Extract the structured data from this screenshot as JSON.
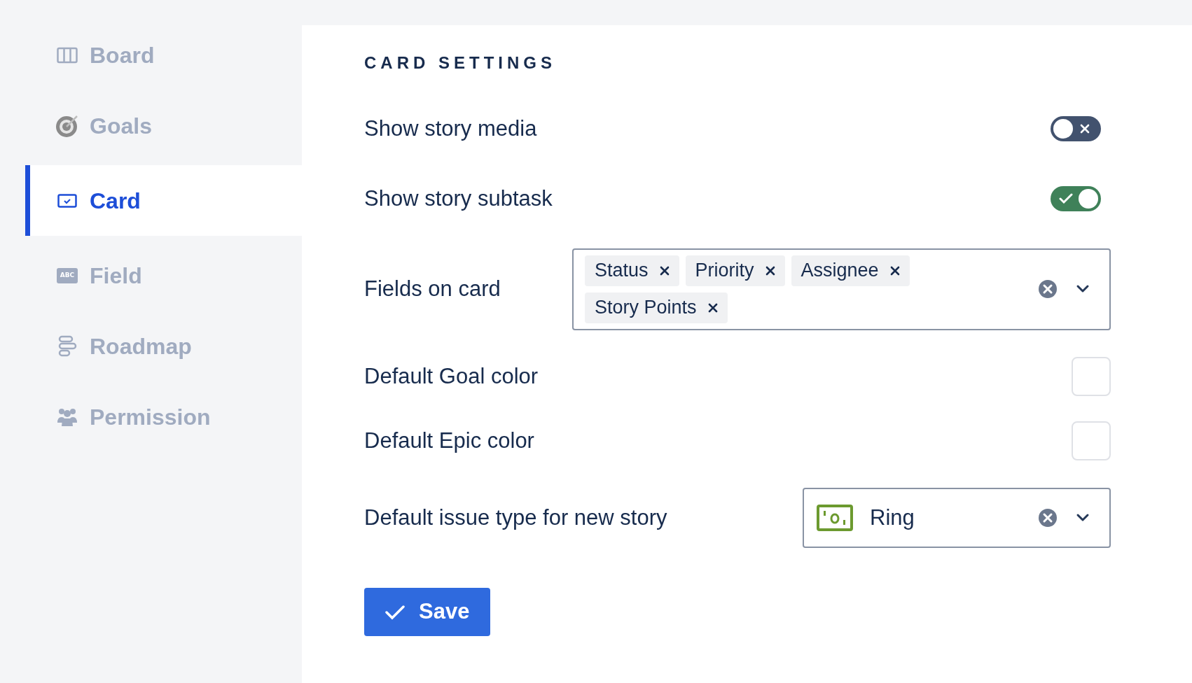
{
  "sidebar": {
    "items": [
      {
        "label": "Board",
        "selected": false
      },
      {
        "label": "Goals",
        "selected": false
      },
      {
        "label": "Card",
        "selected": true
      },
      {
        "label": "Field",
        "icon_text": "ABC",
        "selected": false
      },
      {
        "label": "Roadmap",
        "selected": false
      },
      {
        "label": "Permission",
        "selected": false
      }
    ]
  },
  "settings": {
    "title": "CARD SETTINGS",
    "rows": [
      {
        "kind": "toggle",
        "label": "Show story media",
        "on": false
      },
      {
        "kind": "toggle",
        "label": "Show story subtask",
        "on": true
      },
      {
        "kind": "multiselect",
        "label": "Fields on card",
        "tags": [
          "Status",
          "Priority",
          "Assignee",
          "Story Points"
        ]
      },
      {
        "kind": "color",
        "label": "Default Goal color"
      },
      {
        "kind": "color",
        "label": "Default Epic color"
      },
      {
        "kind": "select",
        "label": "Default issue type for new story",
        "value": "Ring"
      }
    ],
    "save_button": "Save"
  }
}
